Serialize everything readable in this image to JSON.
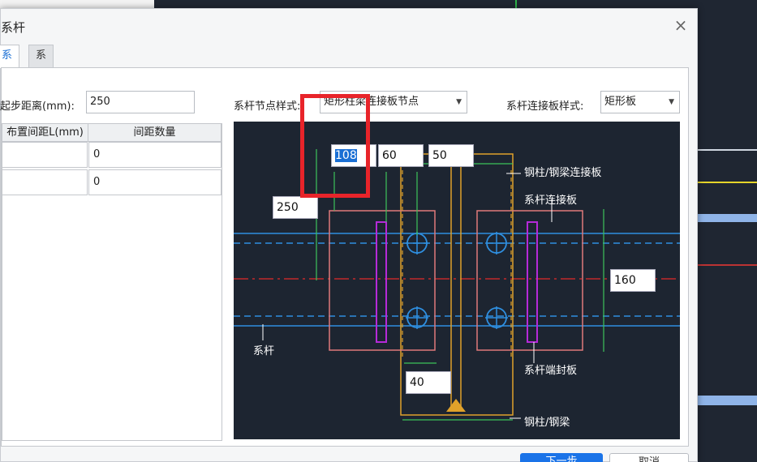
{
  "dialog": {
    "title": "系杆",
    "tabs": [
      "系杆",
      "系杆节点"
    ],
    "start_distance_label": "起步距离(mm):",
    "start_distance_value": "250",
    "table": {
      "headers": [
        "布置间距L(mm)",
        "间距数量"
      ],
      "rows": [
        [
          "",
          "0"
        ],
        [
          "",
          "0"
        ]
      ]
    },
    "node_style_label": "系杆节点样式:",
    "node_style_value": "矩形柱梁连接板节点",
    "plate_style_label": "系杆连接板样式:",
    "plate_style_value": "矩形板",
    "buttons": {
      "ok": "下一步",
      "cancel": "取消"
    }
  },
  "diagram": {
    "inputs": {
      "d1": "108",
      "d2": "60",
      "d3": "50",
      "d4": "250",
      "d5": "160",
      "d6": "40"
    },
    "labels": {
      "column_plate": "钢柱/钢梁连接板",
      "tie_plate": "系杆连接板",
      "tie": "系杆",
      "end_plate": "系杆端封板",
      "column": "钢柱/钢梁"
    }
  },
  "colors": {
    "accent": "#1a73e8",
    "highlight": "#e8242a",
    "canvas_bg": "#1d2531"
  }
}
